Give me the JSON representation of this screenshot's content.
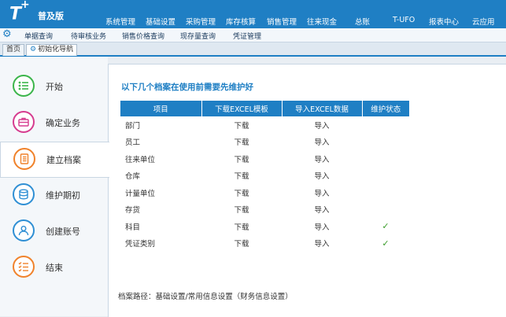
{
  "app": {
    "logo": "T",
    "logo_plus": "+",
    "edition": "普及版"
  },
  "main_nav": [
    "系统管理",
    "基础设置",
    "采购管理",
    "库存核算",
    "销售管理",
    "往来现金",
    "总账",
    "T-UFO",
    "报表中心",
    "云应用"
  ],
  "sub_nav": [
    "单据查询",
    "待审核业务",
    "销售价格查询",
    "现存量查询",
    "凭证管理"
  ],
  "tabs": [
    {
      "label": "首页",
      "active": false
    },
    {
      "label": "初始化导航",
      "active": true
    }
  ],
  "steps": [
    {
      "label": "开始",
      "icon": "list-icon",
      "color": "#3bb54a"
    },
    {
      "label": "确定业务",
      "icon": "briefcase-icon",
      "color": "#d63c8f"
    },
    {
      "label": "建立档案",
      "icon": "document-icon",
      "color": "#f0822b"
    },
    {
      "label": "维护期初",
      "icon": "database-icon",
      "color": "#2f8fd4"
    },
    {
      "label": "创建账号",
      "icon": "user-icon",
      "color": "#2f8fd4"
    },
    {
      "label": "结束",
      "icon": "checklist-icon",
      "color": "#f0822b"
    }
  ],
  "active_step": 2,
  "content": {
    "heading": "以下几个档案在使用前需要先维护好",
    "columns": [
      "项目",
      "下载EXCEL模板",
      "导入EXCEL数据",
      "维护状态"
    ],
    "rows": [
      {
        "name": "部门",
        "download": "下载",
        "import": "导入",
        "status": ""
      },
      {
        "name": "员工",
        "download": "下载",
        "import": "导入",
        "status": ""
      },
      {
        "name": "往来单位",
        "download": "下载",
        "import": "导入",
        "status": ""
      },
      {
        "name": "仓库",
        "download": "下载",
        "import": "导入",
        "status": ""
      },
      {
        "name": "计量单位",
        "download": "下载",
        "import": "导入",
        "status": ""
      },
      {
        "name": "存货",
        "download": "下载",
        "import": "导入",
        "status": ""
      },
      {
        "name": "科目",
        "download": "下载",
        "import": "导入",
        "status": "✓"
      },
      {
        "name": "凭证类别",
        "download": "下载",
        "import": "导入",
        "status": "✓"
      }
    ],
    "path_text": "档案路径：基础设置/常用信息设置（财务信息设置）"
  },
  "colors": {
    "brand": "#1f7fc4",
    "check": "#3a9c2a"
  }
}
